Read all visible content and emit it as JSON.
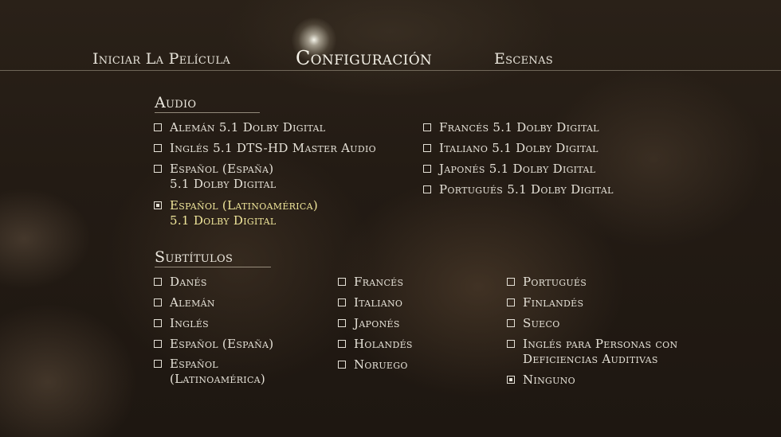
{
  "nav": {
    "items": [
      {
        "label": "Iniciar La Película"
      },
      {
        "label": "Configuración",
        "selected": true
      },
      {
        "label": "Escenas"
      }
    ]
  },
  "audio": {
    "title": "Audio",
    "options": [
      {
        "lines": [
          "Alemán 5.1 Dolby Digital"
        ],
        "checked": false
      },
      {
        "lines": [
          "Inglés 5.1 DTS-HD Master Audio"
        ],
        "checked": false
      },
      {
        "lines": [
          "Español (España)",
          "5.1 Dolby Digital"
        ],
        "checked": false
      },
      {
        "lines": [
          "Español (Latinoamérica)",
          "5.1 Dolby Digital"
        ],
        "checked": true,
        "highlighted": true
      },
      {
        "lines": [
          "Francés 5.1 Dolby Digital"
        ],
        "checked": false
      },
      {
        "lines": [
          "Italiano 5.1 Dolby Digital"
        ],
        "checked": false
      },
      {
        "lines": [
          "Japonés 5.1 Dolby Digital"
        ],
        "checked": false
      },
      {
        "lines": [
          "Portugués 5.1 Dolby Digital"
        ],
        "checked": false
      }
    ]
  },
  "subtitles": {
    "title": "Subtítulos",
    "options": [
      {
        "lines": [
          "Danés"
        ],
        "checked": false
      },
      {
        "lines": [
          "Alemán"
        ],
        "checked": false
      },
      {
        "lines": [
          "Inglés"
        ],
        "checked": false
      },
      {
        "lines": [
          "Español (España)"
        ],
        "checked": false
      },
      {
        "lines": [
          "Español",
          "(Latinoamérica)"
        ],
        "checked": false
      },
      {
        "lines": [
          "Francés"
        ],
        "checked": false
      },
      {
        "lines": [
          "Italiano"
        ],
        "checked": false
      },
      {
        "lines": [
          "Japonés"
        ],
        "checked": false
      },
      {
        "lines": [
          "Holandés"
        ],
        "checked": false
      },
      {
        "lines": [
          "Noruego"
        ],
        "checked": false
      },
      {
        "lines": [
          "Portugués"
        ],
        "checked": false
      },
      {
        "lines": [
          "Finlandés"
        ],
        "checked": false
      },
      {
        "lines": [
          "Sueco"
        ],
        "checked": false
      },
      {
        "lines": [
          "Inglés para Personas con",
          "Deficiencias Auditivas"
        ],
        "checked": false
      },
      {
        "lines": [
          "Ninguno"
        ],
        "checked": true
      }
    ]
  },
  "colors": {
    "text": "#e6e2d8",
    "highlight": "#f0e69a"
  },
  "icons": {
    "checkbox_empty": "checkbox-icon",
    "checkbox_checked": "checkbox-checked-icon"
  }
}
